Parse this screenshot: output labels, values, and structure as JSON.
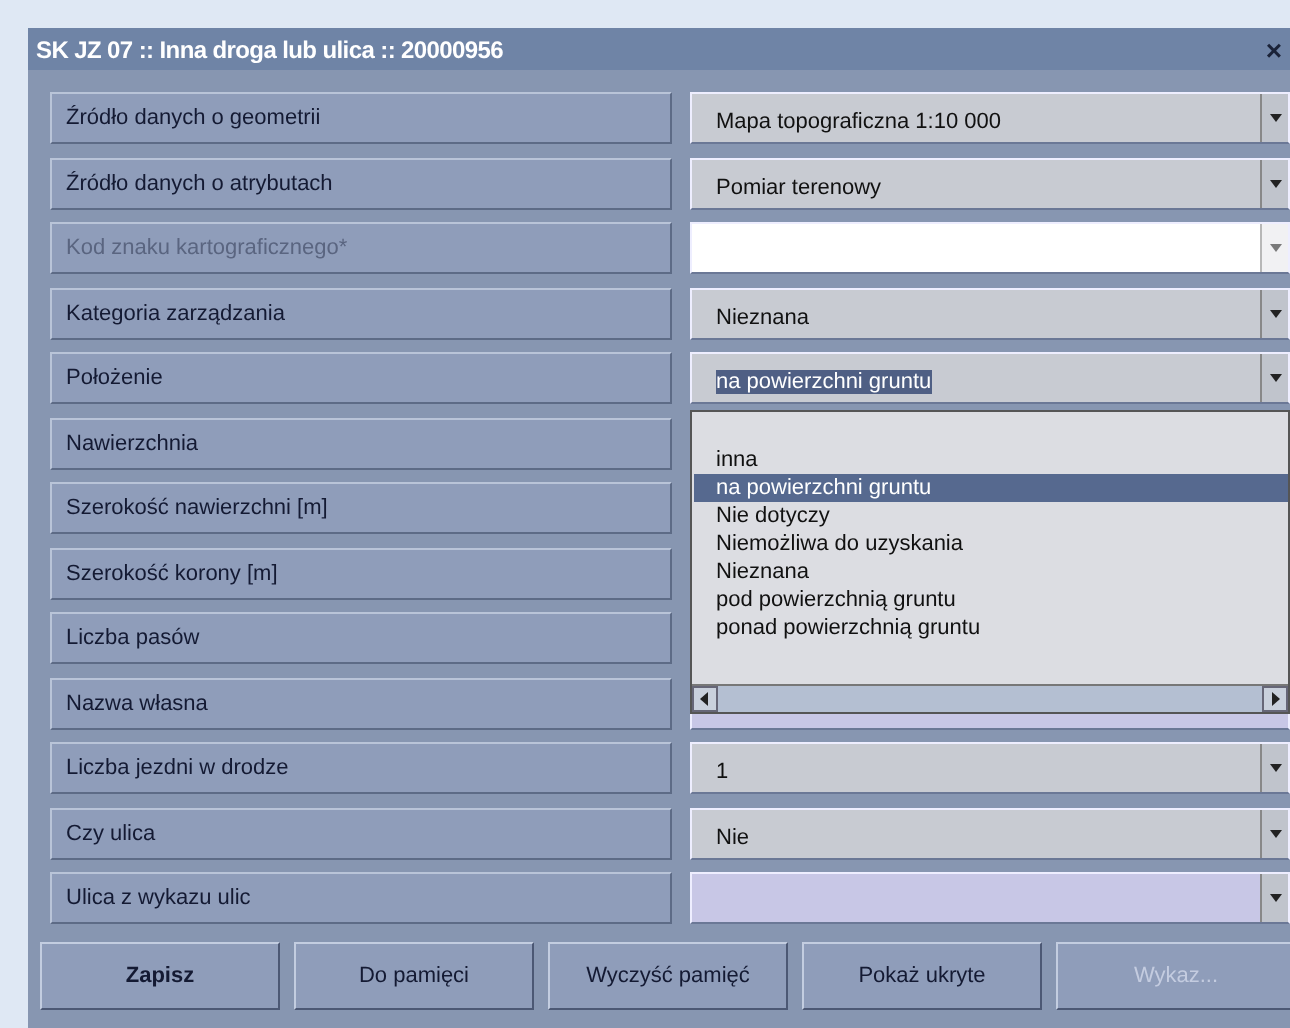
{
  "window": {
    "title": "SK JZ 07 :: Inna droga lub ulica :: 20000956",
    "close": "×"
  },
  "rows": [
    {
      "label": "Źródło danych o geometrii",
      "disabled": false,
      "kind": "combo",
      "value": "Mapa topograficzna 1:10 000"
    },
    {
      "label": "Źródło danych o atrybutach",
      "disabled": false,
      "kind": "combo",
      "value": "Pomiar terenowy"
    },
    {
      "label": "Kod znaku kartograficznego*",
      "disabled": true,
      "kind": "text"
    },
    {
      "label": "Kategoria zarządzania",
      "disabled": false,
      "kind": "combo",
      "value": "Nieznana"
    },
    {
      "label": "Położenie",
      "disabled": false,
      "kind": "combo",
      "value": "na powierzchni gruntu",
      "highlighted": true
    },
    {
      "label": "Nawierzchnia",
      "disabled": false,
      "kind": "covered"
    },
    {
      "label": "Szerokość nawierzchni [m]",
      "disabled": false,
      "kind": "covered"
    },
    {
      "label": "Szerokość korony [m]",
      "disabled": false,
      "kind": "covered"
    },
    {
      "label": "Liczba pasów",
      "disabled": false,
      "kind": "covered"
    },
    {
      "label": "Nazwa własna",
      "disabled": false,
      "kind": "hidden"
    },
    {
      "label": "Liczba jezdni w drodze",
      "disabled": false,
      "kind": "combo",
      "value": "1"
    },
    {
      "label": "Czy ulica",
      "disabled": false,
      "kind": "combo",
      "value": "Nie"
    },
    {
      "label": "Ulica z wykazu ulic",
      "disabled": false,
      "kind": "lookup"
    }
  ],
  "dropdown": {
    "options": [
      {
        "label": "inna",
        "selected": false
      },
      {
        "label": "na powierzchni gruntu",
        "selected": true
      },
      {
        "label": "Nie dotyczy",
        "selected": false
      },
      {
        "label": "Niemożliwa do uzyskania",
        "selected": false
      },
      {
        "label": "Nieznana",
        "selected": false
      },
      {
        "label": "pod powierzchnią gruntu",
        "selected": false
      },
      {
        "label": "ponad powierzchnią gruntu",
        "selected": false
      }
    ]
  },
  "buttons": [
    {
      "label": "Zapisz",
      "bold": true,
      "disabled": false
    },
    {
      "label": "Do pamięci",
      "bold": false,
      "disabled": false
    },
    {
      "label": "Wyczyść pamięć",
      "bold": false,
      "disabled": false
    },
    {
      "label": "Pokaż ukryte",
      "bold": false,
      "disabled": false
    },
    {
      "label": "Wykaz...",
      "bold": false,
      "disabled": true
    }
  ]
}
